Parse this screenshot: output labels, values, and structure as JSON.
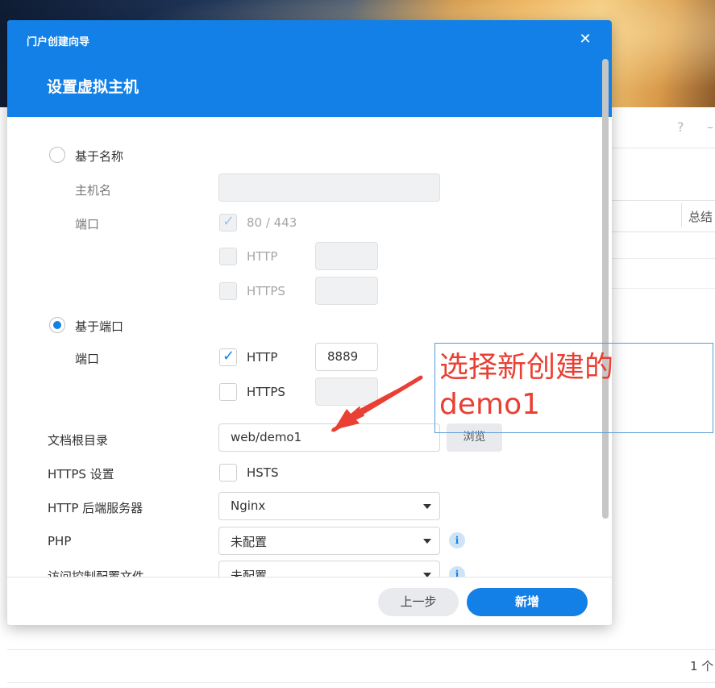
{
  "background": {
    "help_icon_glyph": "?",
    "minimize_glyph": "–",
    "table_header_label": "总结",
    "footer_count": "1 个"
  },
  "dialog": {
    "title": "门户创建向导",
    "close_glyph": "✕",
    "heading": "设置虚拟主机",
    "name_based": {
      "label": "基于名称",
      "selected": false,
      "hostname_label": "主机名",
      "hostname_value": "",
      "port_label": "端口",
      "default_ports_label": "80 / 443",
      "default_ports_checked": true,
      "http_label": "HTTP",
      "http_checked": false,
      "http_port": "",
      "https_label": "HTTPS",
      "https_checked": false,
      "https_port": ""
    },
    "port_based": {
      "label": "基于端口",
      "selected": true,
      "port_label": "端口",
      "http_label": "HTTP",
      "http_checked": true,
      "http_port": "8889",
      "https_label": "HTTPS",
      "https_checked": false,
      "https_port": ""
    },
    "doc_root": {
      "label": "文档根目录",
      "value": "web/demo1",
      "browse_label": "浏览"
    },
    "https_settings": {
      "label": "HTTPS 设置",
      "hsts_label": "HSTS",
      "hsts_checked": false
    },
    "backend": {
      "label": "HTTP 后端服务器",
      "value": "Nginx"
    },
    "php": {
      "label": "PHP",
      "value": "未配置"
    },
    "access_control": {
      "label": "访问控制配置文件",
      "value": "未配置"
    },
    "footer": {
      "prev_label": "上一步",
      "new_label": "新增"
    }
  },
  "annotation": {
    "line1": "选择新创建的",
    "line2": "demo1",
    "color": "#ea3f33"
  },
  "colors": {
    "accent": "#1280e6",
    "annotation_red": "#ea3f33"
  }
}
